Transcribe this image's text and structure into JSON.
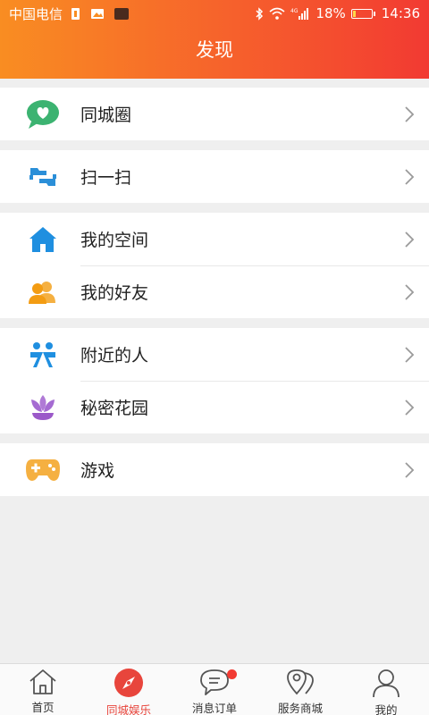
{
  "status_bar": {
    "carrier": "中国电信",
    "battery": "18%",
    "battery_level": 0.18,
    "time": "14:36",
    "network": "4G"
  },
  "header": {
    "title": "发现"
  },
  "menu": [
    {
      "label": "同城圈",
      "icon": "chat-bubble-heart-icon"
    },
    {
      "label": "扫一扫",
      "icon": "scan-icon"
    },
    {
      "label": "我的空间",
      "icon": "home-icon"
    },
    {
      "label": "我的好友",
      "icon": "friends-icon"
    },
    {
      "label": "附近的人",
      "icon": "nearby-people-icon"
    },
    {
      "label": "秘密花园",
      "icon": "lotus-icon"
    },
    {
      "label": "游戏",
      "icon": "gamepad-icon"
    }
  ],
  "tabbar": {
    "items": [
      {
        "label": "首页",
        "icon": "house-icon"
      },
      {
        "label": "同城娱乐",
        "icon": "compass-icon",
        "active": true
      },
      {
        "label": "消息订单",
        "icon": "message-icon",
        "badge": true
      },
      {
        "label": "服务商城",
        "icon": "location-pin-icon"
      },
      {
        "label": "我的",
        "icon": "user-icon"
      }
    ]
  },
  "colors": {
    "header_start": "#f98d22",
    "header_end": "#f23a32",
    "active_tab": "#e8453c",
    "badge": "#f23a32"
  }
}
